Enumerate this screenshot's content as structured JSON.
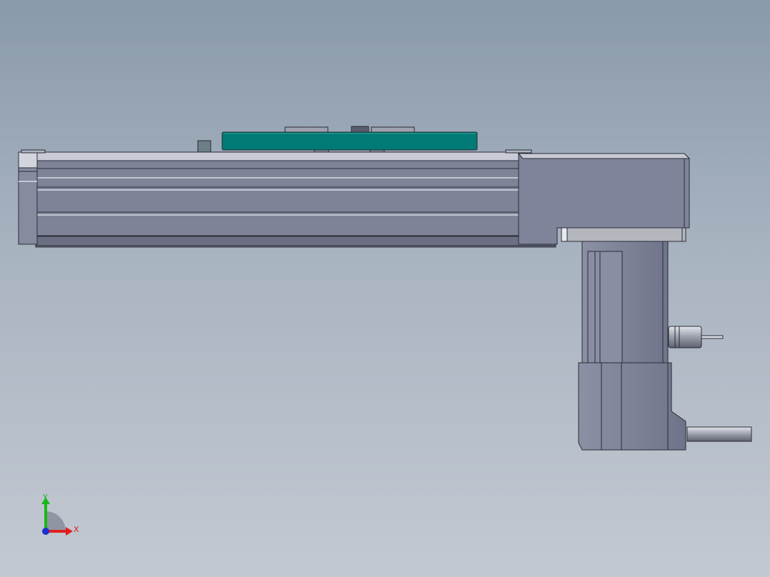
{
  "viewport": {
    "background_top": "#8a9aaa",
    "background_bottom": "#c3c9d2"
  },
  "model": {
    "body_color": "#7f8397",
    "carriage_color": "#007a74",
    "outline_color": "#2a2c36"
  },
  "triad": {
    "x_label": "X",
    "y_label": "Y",
    "x_color": "#e02020",
    "y_color": "#18b818",
    "z_color": "#1b2fd0"
  }
}
